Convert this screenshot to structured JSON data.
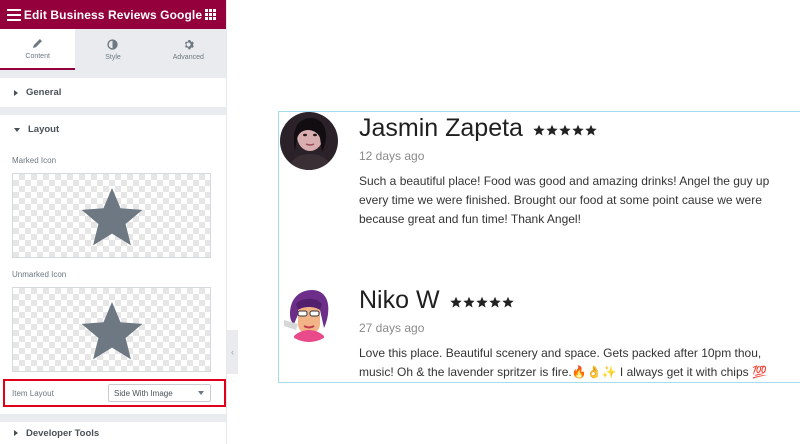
{
  "panel": {
    "title": "Edit Business Reviews Google",
    "tabs": [
      {
        "label": "Content",
        "icon": "pencil-icon",
        "active": true
      },
      {
        "label": "Style",
        "icon": "half-circle-icon",
        "active": false
      },
      {
        "label": "Advanced",
        "icon": "gear-icon",
        "active": false
      }
    ],
    "sections": {
      "general": "General",
      "layout": "Layout",
      "developer_tools": "Developer Tools"
    },
    "marked_icon_label": "Marked Icon",
    "unmarked_icon_label": "Unmarked Icon",
    "item_layout": {
      "label": "Item Layout",
      "value": "Side With Image"
    },
    "accent_color": "#93003c"
  },
  "reviews": [
    {
      "name": "Jasmin Zapeta",
      "rating": 5,
      "date": "12 days ago",
      "text_lines": [
        "Such a beautiful place! Food was good and amazing drinks! Angel the guy up",
        "every time we were finished. Brought our food at some point cause we were",
        "because great and fun time! Thank Angel!"
      ]
    },
    {
      "name": "Niko W",
      "rating": 5,
      "date": "27 days ago",
      "text_lines": [
        "Love this place. Beautiful scenery and space. Gets packed after 10pm thou,",
        "music! Oh & the lavender spritzer is fire.🔥👌✨ I always get it with chips 💯"
      ]
    }
  ]
}
